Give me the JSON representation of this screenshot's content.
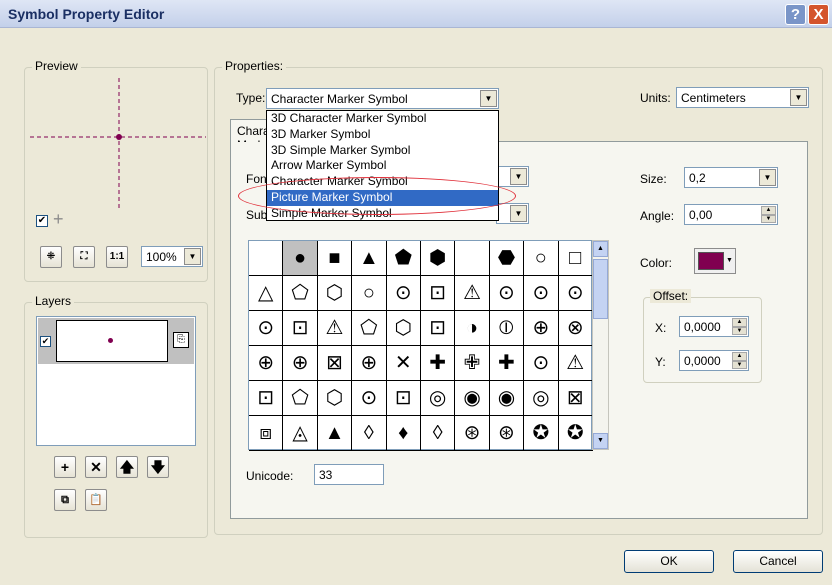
{
  "title": "Symbol Property Editor",
  "titlebar": {
    "help": "?",
    "close": "X"
  },
  "preview": {
    "label": "Preview",
    "zoom": "100%",
    "zoom_icons": [
      "fit-extent-icon",
      "zoom-full-icon",
      "actual-size-icon"
    ]
  },
  "layers": {
    "label": "Layers",
    "tools": {
      "add": "+",
      "remove": "✕",
      "up": "🡅",
      "down": "🡇"
    }
  },
  "properties": {
    "label": "Properties:",
    "type_label": "Type:",
    "type_value": "Character Marker Symbol",
    "units_label": "Units:",
    "units_value": "Centimeters"
  },
  "tab": {
    "label": "Character Marker"
  },
  "dropdown": {
    "items": [
      "3D Character Marker Symbol",
      "3D Marker Symbol",
      "3D Simple Marker Symbol",
      "Arrow Marker Symbol",
      "Character Marker Symbol",
      "Picture Marker Symbol",
      "Simple Marker Symbol"
    ],
    "selected": "Picture Marker Symbol"
  },
  "font_label": "Font:",
  "subset_label": "Subset:",
  "size": {
    "label": "Size:",
    "value": "0,2"
  },
  "angle": {
    "label": "Angle:",
    "value": "0,00"
  },
  "color": {
    "label": "Color:",
    "swatch": "#800050"
  },
  "offset": {
    "label": "Offset:",
    "x_label": "X:",
    "x_value": "0,0000",
    "y_label": "Y:",
    "y_value": "0,0000"
  },
  "unicode": {
    "label": "Unicode:",
    "value": "33"
  },
  "glyphs": [
    [
      "",
      "●",
      "■",
      "▲",
      "⬟",
      "⬢",
      "",
      "⬣",
      "○",
      "□"
    ],
    [
      "△",
      "⬠",
      "⬡",
      "○",
      "⊙",
      "⊡",
      "⚠",
      "⊙",
      "⊙",
      "⊙"
    ],
    [
      "⊙",
      "⊡",
      "⚠",
      "⬠",
      "⬡",
      "⊡",
      "◑",
      "⦶",
      "⊕",
      "⊗"
    ],
    [
      "⊕",
      "⊕",
      "⊠",
      "⊕",
      "✕",
      "✚",
      "✙",
      "✚",
      "⊙",
      "⚠"
    ],
    [
      "⊡",
      "⬠",
      "⬡",
      "⊙",
      "⊡",
      "◎",
      "◉",
      "◉",
      "◎",
      "⊠"
    ],
    [
      "⧈",
      "◬",
      "▲",
      "◊",
      "♦",
      "◊",
      "⊛",
      "⊛",
      "✪",
      "✪"
    ]
  ],
  "buttons": {
    "ok": "OK",
    "cancel": "Cancel"
  }
}
